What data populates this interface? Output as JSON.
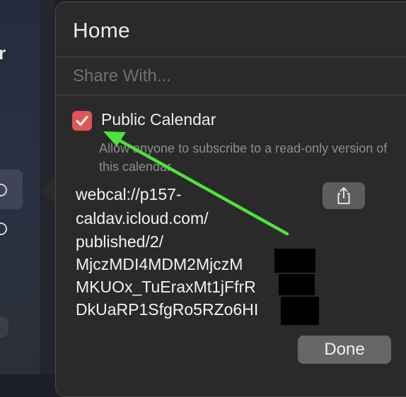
{
  "popover": {
    "title": "Home",
    "share_with_placeholder": "Share With...",
    "public_calendar": {
      "label": "Public Calendar",
      "checked": true,
      "description": "Allow anyone to subscribe to a read-only version of this calendar."
    },
    "url_lines": [
      "webcal://p157-",
      "caldav.icloud.com/",
      "published/2/",
      "MjczMDI4MDM2MjczM",
      "MKUOx_TuEraxMt1jFfrR",
      "DkUaRP1SfgRo5RZo6HI"
    ],
    "share_icon": "share-icon",
    "done_label": "Done"
  },
  "background": {
    "sidebar_letter": "r"
  },
  "colors": {
    "checkbox": "#e15552",
    "annotation_arrow": "#4ee33a",
    "popover_bg": "#2a2a2b"
  }
}
